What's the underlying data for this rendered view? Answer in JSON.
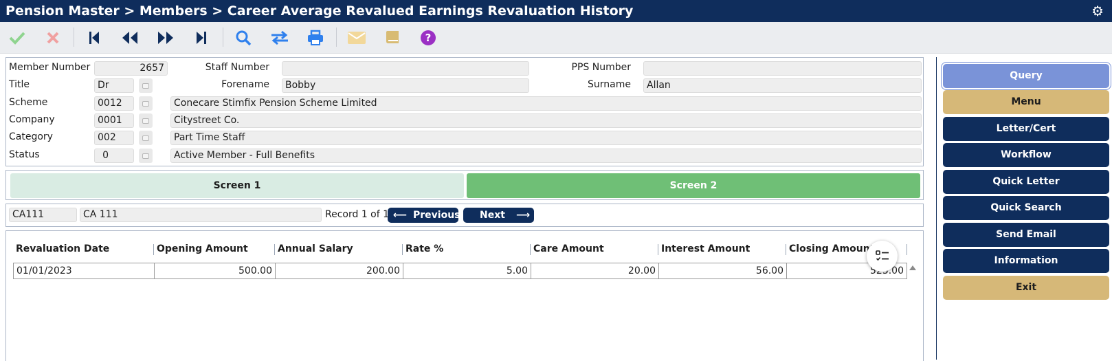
{
  "header": {
    "breadcrumb": "Pension Master > Members > Career Average Revalued Earnings Revaluation History"
  },
  "member": {
    "member_number_label": "Member Number",
    "member_number": "2657",
    "staff_number_label": "Staff Number",
    "staff_number": "",
    "pps_number_label": "PPS Number",
    "pps_number": "",
    "title_label": "Title",
    "title": "Dr",
    "forename_label": "Forename",
    "forename": "Bobby",
    "surname_label": "Surname",
    "surname": "Allan",
    "scheme_label": "Scheme",
    "scheme_code": "0012",
    "scheme_name": "Conecare Stimfix Pension Scheme Limited",
    "company_label": "Company",
    "company_code": "0001",
    "company_name": "Citystreet Co.",
    "category_label": "Category",
    "category_code": "002",
    "category_name": "Part Time Staff",
    "status_label": "Status",
    "status_code": "0",
    "status_name": "Active Member - Full Benefits"
  },
  "screens": {
    "screen1": "Screen 1",
    "screen2": "Screen 2"
  },
  "record": {
    "code": "CA111",
    "name": "CA 111",
    "position": "Record 1 of 1",
    "previous_label": "Previous",
    "next_label": "Next"
  },
  "grid": {
    "columns": [
      "Revaluation Date",
      "Opening Amount",
      "Annual Salary",
      "Rate %",
      "Care Amount",
      "Interest Amount",
      "Closing Amount"
    ],
    "rows": [
      [
        "01/01/2023",
        "500.00",
        "200.00",
        "5.00",
        "20.00",
        "56.00",
        "523.00"
      ]
    ]
  },
  "side_buttons": {
    "query": "Query",
    "menu": "Menu",
    "letter_cert": "Letter/Cert",
    "workflow": "Workflow",
    "quick_letter": "Quick Letter",
    "quick_search": "Quick Search",
    "send_email": "Send Email",
    "information": "Information",
    "exit": "Exit"
  },
  "icons": {
    "toolbar": [
      "check-icon",
      "cross-icon",
      "first-record-icon",
      "previous-record-icon",
      "next-record-icon",
      "last-record-icon",
      "search-icon",
      "swap-icon",
      "print-icon",
      "mail-icon",
      "book-icon",
      "help-icon"
    ],
    "settings": "gear-icon",
    "column_chooser": "column-list-icon"
  },
  "colors": {
    "navy": "#0f2d5c",
    "gold": "#d6b878",
    "query_blue": "#7a93d8",
    "screen_active": "#6fbf76",
    "screen_inactive": "#d9ece3",
    "accent_blue": "#2f80ed",
    "help_purple": "#9b30c4"
  }
}
